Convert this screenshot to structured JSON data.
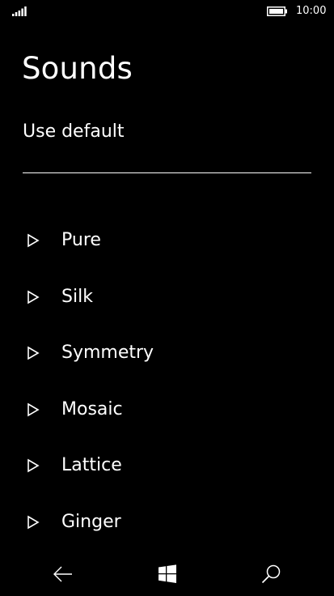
{
  "status_bar": {
    "time": "10:00",
    "signal_icon": "signal-bars-icon",
    "battery_icon": "battery-icon"
  },
  "page": {
    "title": "Sounds",
    "default_option": "Use default"
  },
  "sounds": [
    {
      "label": "Pure",
      "icon": "play-icon"
    },
    {
      "label": "Silk",
      "icon": "play-icon"
    },
    {
      "label": "Symmetry",
      "icon": "play-icon"
    },
    {
      "label": "Mosaic",
      "icon": "play-icon"
    },
    {
      "label": "Lattice",
      "icon": "play-icon"
    },
    {
      "label": "Ginger",
      "icon": "play-icon"
    }
  ],
  "nav_bar": {
    "back_icon": "back-arrow-icon",
    "start_icon": "windows-logo-icon",
    "search_icon": "search-icon"
  },
  "colors": {
    "background": "#000000",
    "text": "#ffffff"
  }
}
